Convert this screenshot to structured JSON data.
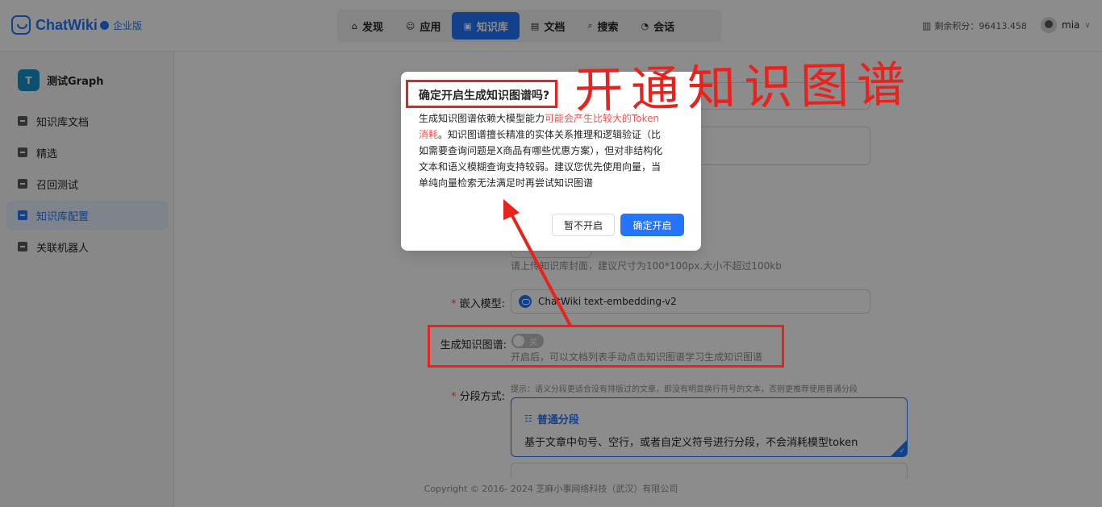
{
  "header": {
    "logo_text": "ChatWiki",
    "edition": "企业版",
    "nav": [
      {
        "label": "发现",
        "icon": "compass-icon",
        "glyph": "⌂"
      },
      {
        "label": "应用",
        "icon": "robot-icon",
        "glyph": "☺"
      },
      {
        "label": "知识库",
        "icon": "book-icon",
        "glyph": "▣"
      },
      {
        "label": "文档",
        "icon": "document-icon",
        "glyph": "▤"
      },
      {
        "label": "搜索",
        "icon": "search-icon",
        "glyph": "⌕"
      },
      {
        "label": "会话",
        "icon": "chat-icon",
        "glyph": "◔"
      }
    ],
    "active_nav": "知识库",
    "credits": "剩余积分：96413.458",
    "username": "mia"
  },
  "sidebar": {
    "kb_badge": "T",
    "kb_name": "测试Graph",
    "items": [
      {
        "label": "知识库文档"
      },
      {
        "label": "精选"
      },
      {
        "label": "召回测试"
      },
      {
        "label": "知识库配置"
      },
      {
        "label": "关联机器人"
      }
    ],
    "active_item": "知识库配置"
  },
  "form": {
    "cover_hint": "请上传知识库封面，建议尺寸为100*100px.大小不超过100kb",
    "embed_label": "嵌入模型:",
    "embed_value": "ChatWiki text-embedding-v2",
    "graph_label": "生成知识图谱:",
    "graph_toggle_text": "关",
    "graph_hint": "开启后，可以文档列表手动点击知识图谱学习生成知识图谱",
    "segment_label": "分段方式:",
    "segment_tip": "提示：语义分段更适合没有排版过的文章，即没有明显换行符号的文本，否则更推荐使用普通分段",
    "segment_option_title": "普通分段",
    "segment_option_desc": "基于文章中句号、空行，或者自定义符号进行分段，不会消耗模型token"
  },
  "modal": {
    "title": "确定开启生成知识图谱吗?",
    "body_pre": "生成知识图谱依赖大模型能力",
    "body_warn": "可能会产生比较大的Token消耗",
    "body_post": "。知识图谱擅长精准的实体关系推理和逻辑验证（比如需要查询问题是X商品有哪些优惠方案），但对非结构化文本和语义模糊查询支持较弱。建议您优先使用向量，当单纯向量检索无法满足时再尝试知识图谱",
    "cancel": "暂不开启",
    "confirm": "确定开启"
  },
  "annotation": {
    "handwritten_text": "开通知识图谱"
  },
  "footer": {
    "copyright": "Copyright © 2016- 2024 芝麻小事网络科技（武汉）有限公司"
  },
  "colors": {
    "primary": "#2475fc",
    "annotation_red": "#e8221c",
    "warning_text": "#ff4d4f"
  }
}
